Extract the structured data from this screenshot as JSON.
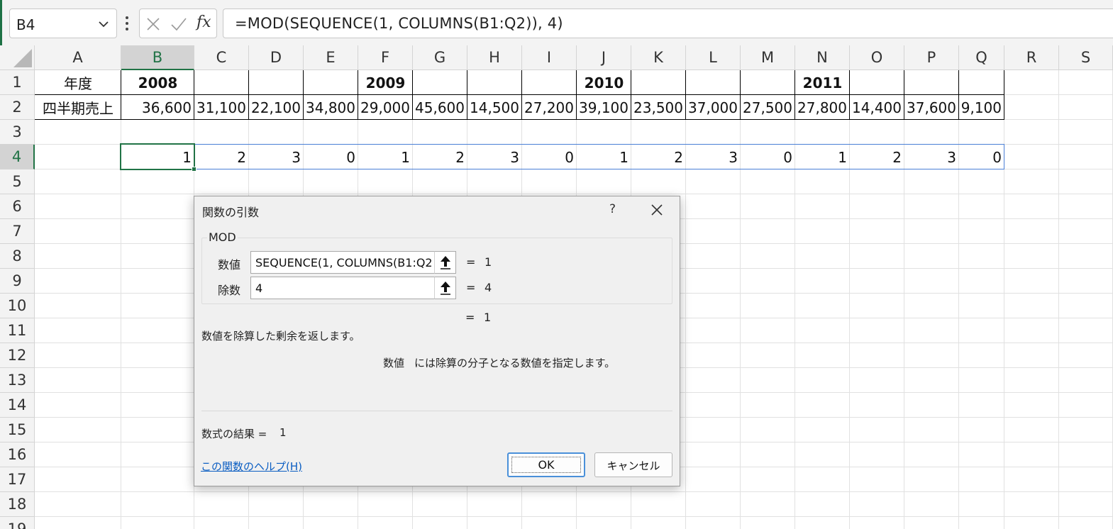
{
  "formula_bar": {
    "name_box": "B4",
    "fx_label": "fx",
    "formula": "=MOD(SEQUENCE(1, COLUMNS(B1:Q2)), 4)"
  },
  "columns": [
    "A",
    "B",
    "C",
    "D",
    "E",
    "F",
    "G",
    "H",
    "I",
    "J",
    "K",
    "L",
    "M",
    "N",
    "O",
    "P",
    "Q",
    "R",
    "S"
  ],
  "rows": [
    "1",
    "2",
    "3",
    "4",
    "5",
    "6",
    "7",
    "8",
    "9",
    "10",
    "11",
    "12",
    "13",
    "14",
    "15",
    "16",
    "17",
    "18",
    "19"
  ],
  "selected_cell": {
    "column": "B",
    "row": "4"
  },
  "sheet": {
    "row1": [
      "年度",
      "2008",
      "",
      "",
      "",
      "2009",
      "",
      "",
      "",
      "2010",
      "",
      "",
      "",
      "2011",
      "",
      "",
      ""
    ],
    "row2": [
      "四半期売上",
      "36,600",
      "31,100",
      "22,100",
      "34,800",
      "29,000",
      "45,600",
      "14,500",
      "27,200",
      "39,100",
      "23,500",
      "37,000",
      "27,500",
      "27,800",
      "14,400",
      "37,600",
      "9,100"
    ],
    "row4": [
      "",
      "1",
      "2",
      "3",
      "0",
      "1",
      "2",
      "3",
      "0",
      "1",
      "2",
      "3",
      "0",
      "1",
      "2",
      "3",
      "0"
    ]
  },
  "dialog": {
    "title": "関数の引数",
    "help_glyph": "?",
    "function_name": "MOD",
    "args": [
      {
        "label": "数値",
        "value": "SEQUENCE(1, COLUMNS(B1:Q2",
        "result": "1"
      },
      {
        "label": "除数",
        "value": "4",
        "result": "4"
      }
    ],
    "equals": "=",
    "total_result": "1",
    "description": "数値を除算した剰余を返します。",
    "arg_description_name": "数値",
    "arg_description": "には除算の分子となる数値を指定します。",
    "result_label": "数式の結果 =",
    "result_value": "1",
    "help_link": "この関数のヘルプ(H)",
    "ok_label": "OK",
    "cancel_label": "キャンセル"
  }
}
